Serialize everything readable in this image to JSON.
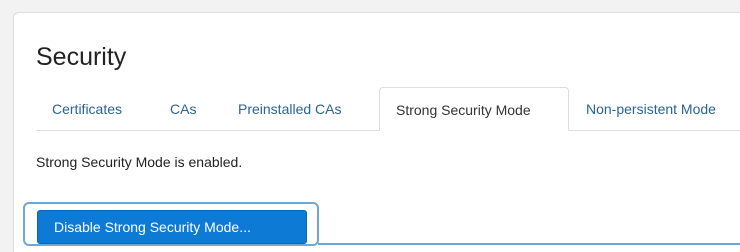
{
  "page": {
    "title": "Security"
  },
  "tabs": [
    {
      "label": "Certificates",
      "active": false
    },
    {
      "label": "CAs",
      "active": false
    },
    {
      "label": "Preinstalled CAs",
      "active": false
    },
    {
      "label": "Strong Security Mode",
      "active": true
    },
    {
      "label": "Non-persistent Mode",
      "active": false
    }
  ],
  "content": {
    "status_text": "Strong Security Mode is enabled.",
    "disable_button_label": "Disable Strong Security Mode..."
  },
  "colors": {
    "link": "#2a6496",
    "primary_button": "#0d7bd6",
    "focus_ring": "#6fa8d6"
  }
}
